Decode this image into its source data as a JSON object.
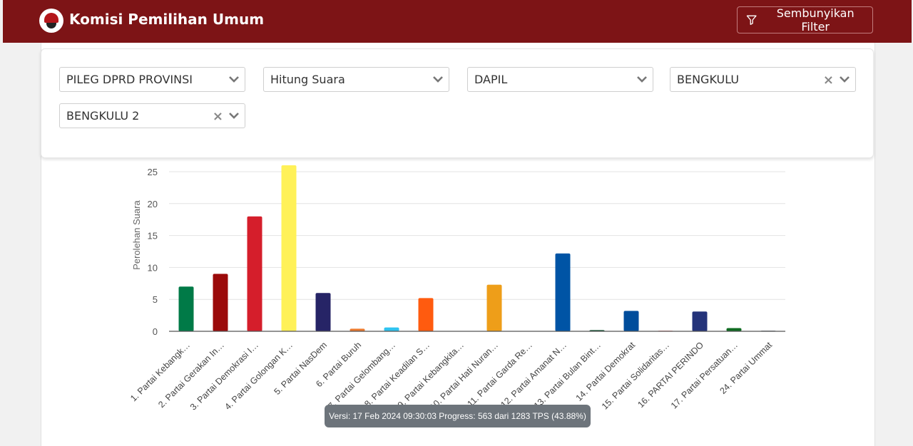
{
  "header": {
    "title": "Komisi Pemilihan Umum",
    "filter_button": "Sembunyikan Filter"
  },
  "filters": [
    {
      "value": "PILEG DPRD PROVINSI",
      "clearable": false
    },
    {
      "value": "Hitung Suara",
      "clearable": false
    },
    {
      "value": "DAPIL",
      "clearable": false
    },
    {
      "value": "BENGKULU",
      "clearable": true
    },
    {
      "value": "BENGKULU 2",
      "clearable": true
    }
  ],
  "chart_data": {
    "type": "bar",
    "ylabel": "Perolehan Suara",
    "ylim": [
      0,
      25
    ],
    "yticks": [
      0,
      5,
      10,
      15,
      20,
      25
    ],
    "categories": [
      "1. Partai Kebangk…",
      "2. Partai Gerakan In…",
      "3. Partai Demokrasi I…",
      "4. Partai Golongan K…",
      "5. Partai NasDem",
      "6. Partai Buruh",
      "7. Partai Gelombang…",
      "8. Partai Keadilan S…",
      "9. Partai Kebangkita…",
      "10. Partai Hati Nuran…",
      "11. Partai Garda Re…",
      "12. Partai Amanat N…",
      "13. Partai Bulan Bint…",
      "14. Partai Demokrat",
      "15. Partai Solidaritas…",
      "16. PARTAI PERINDO",
      "17. Partai Persatuan…",
      "24. Partai Ummat"
    ],
    "values": [
      7,
      9,
      18,
      26,
      6,
      0.4,
      0.6,
      5.2,
      0,
      7.3,
      0,
      12.2,
      0.2,
      3.2,
      0.1,
      3.1,
      0.5,
      0.1
    ],
    "colors": [
      "#007a47",
      "#9b0a0a",
      "#d51e2b",
      "#fff158",
      "#262466",
      "#ec7a2f",
      "#2fc3ef",
      "#ff5b0f",
      "#0c7c3a",
      "#ee9e19",
      "#7a1e21",
      "#0054a5",
      "#1d5a3b",
      "#004d9c",
      "#f17f7f",
      "#24337a",
      "#0f6b21",
      "#54606c"
    ]
  },
  "tooltip": "Versi: 17 Feb 2024 09:30:03 Progress: 563 dari 1283 TPS (43.88%)"
}
